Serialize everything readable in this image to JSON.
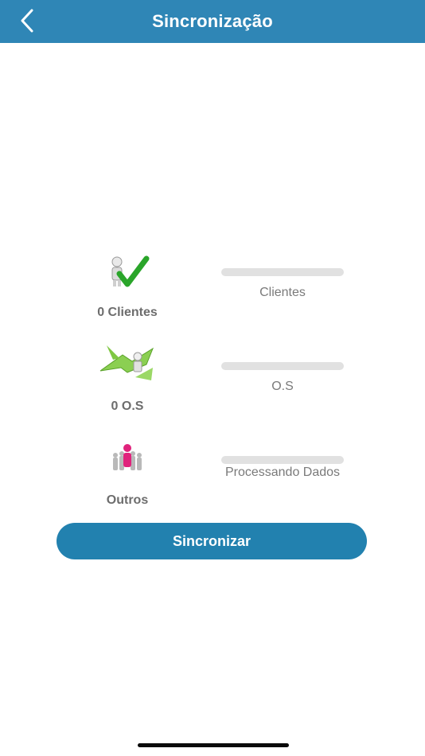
{
  "header": {
    "title": "Sincronização",
    "back_icon": "chevron-left-icon",
    "background": "#2f86b6"
  },
  "sync_items": [
    {
      "icon": "clients-check-icon",
      "label": "0 Clientes",
      "caption": "Clientes",
      "progress": 0
    },
    {
      "icon": "service-order-arrows-icon",
      "label": "0 O.S",
      "caption": "O.S",
      "progress": 0
    },
    {
      "icon": "others-person-icon",
      "label": "Outros",
      "caption": "Processando Dados",
      "progress": 0
    }
  ],
  "actions": {
    "sync_label": "Sincronizar",
    "sync_color": "#2281af"
  }
}
